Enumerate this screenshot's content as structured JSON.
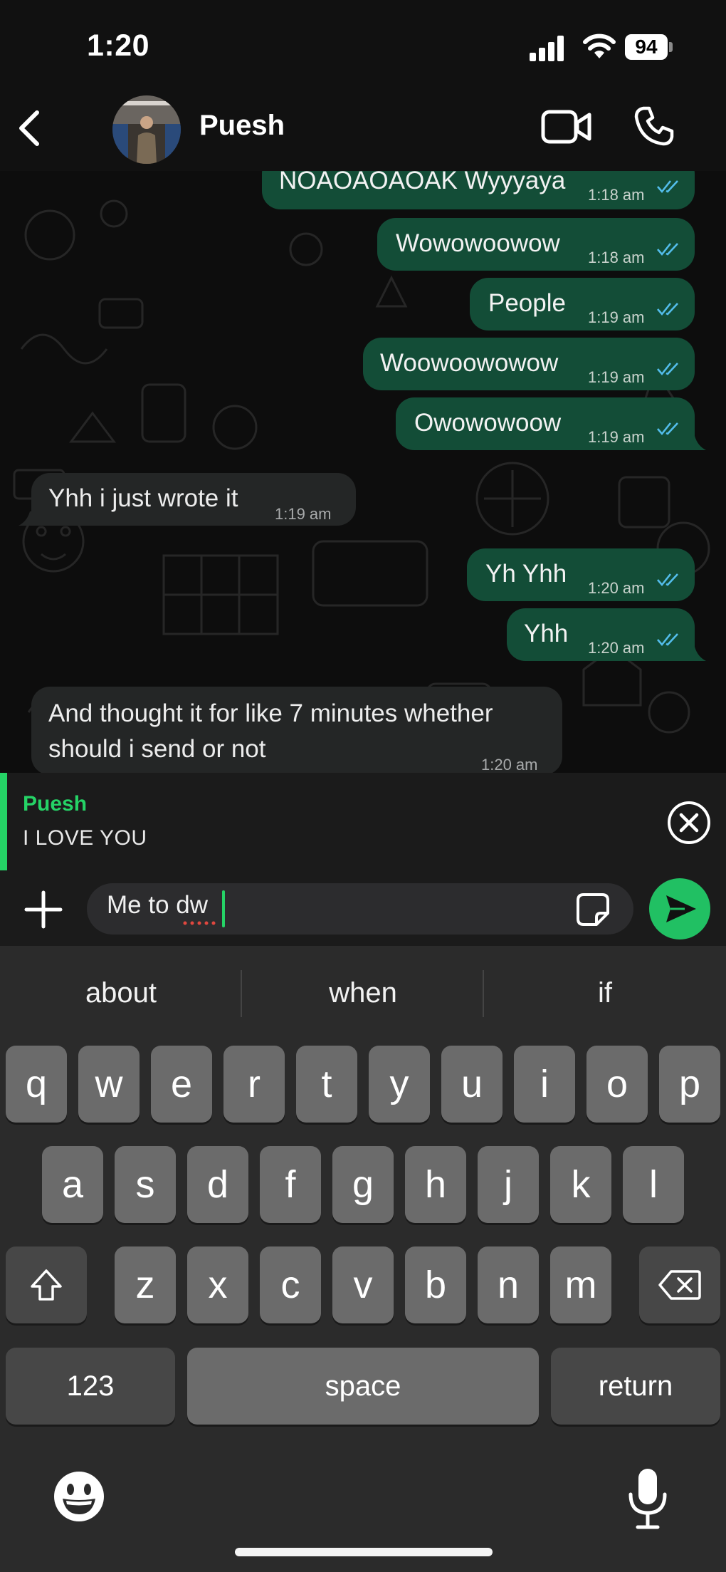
{
  "status_bar": {
    "time": "1:20",
    "battery": "94"
  },
  "header": {
    "contact_name": "Puesh"
  },
  "messages": [
    {
      "dir": "out",
      "text": "NOAOAOAOAK Wyyyaya",
      "time": "1:18 am",
      "read": true
    },
    {
      "dir": "out",
      "text": "Wowowoowow",
      "time": "1:18 am",
      "read": true
    },
    {
      "dir": "out",
      "text": "People",
      "time": "1:19 am",
      "read": true
    },
    {
      "dir": "out",
      "text": "Woowoowowow",
      "time": "1:19 am",
      "read": true
    },
    {
      "dir": "out",
      "text": "Owowowoow",
      "time": "1:19 am",
      "read": true
    },
    {
      "dir": "in",
      "text": "Yhh i just wrote it",
      "time": "1:19 am"
    },
    {
      "dir": "out",
      "text": "Yh Yhh",
      "time": "1:20 am",
      "read": true
    },
    {
      "dir": "out",
      "text": "Yhh",
      "time": "1:20 am",
      "read": true
    },
    {
      "dir": "in",
      "text_line1": "And thought it for like 7 minutes whether",
      "text_line2": "should i send or not",
      "time": "1:20 am"
    }
  ],
  "reply_preview": {
    "name": "Puesh",
    "text": "I LOVE YOU"
  },
  "composer": {
    "text": "Me to dw"
  },
  "keyboard": {
    "suggestions": [
      "about",
      "when",
      "if"
    ],
    "row1": [
      "q",
      "w",
      "e",
      "r",
      "t",
      "y",
      "u",
      "i",
      "o",
      "p"
    ],
    "row2": [
      "a",
      "s",
      "d",
      "f",
      "g",
      "h",
      "j",
      "k",
      "l"
    ],
    "row3": [
      "z",
      "x",
      "c",
      "v",
      "b",
      "n",
      "m"
    ],
    "numbers_label": "123",
    "space_label": "space",
    "return_label": "return"
  },
  "colors": {
    "accent": "#25d366",
    "outgoing_bubble": "#134d37",
    "incoming_bubble": "#242626",
    "read_ticks": "#53bdeb"
  }
}
